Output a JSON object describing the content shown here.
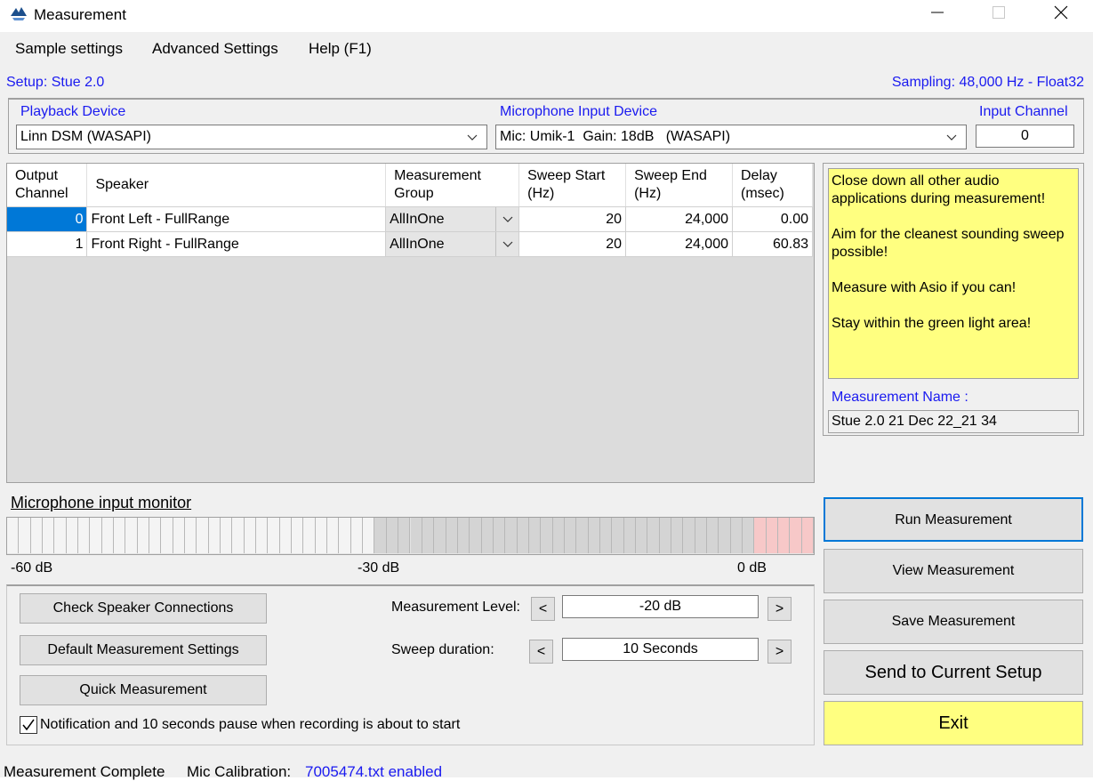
{
  "window": {
    "title": "Measurement",
    "controls": [
      "minimize",
      "maximize",
      "close"
    ]
  },
  "menu": [
    "Sample settings",
    "Advanced Settings",
    "Help (F1)"
  ],
  "setup": {
    "label": "Setup: Stue 2.0",
    "sampling": "Sampling: 48,000 Hz - Float32"
  },
  "devices": {
    "playback_label": "Playback Device",
    "playback_value": "Linn DSM (WASAPI)",
    "mic_label": "Microphone Input Device",
    "mic_value": "Mic: Umik-1  Gain: 18dB   (WASAPI)",
    "input_channel_label": "Input Channel",
    "input_channel_value": "0"
  },
  "table": {
    "headers": {
      "output_channel": [
        "Output",
        "Channel"
      ],
      "speaker": [
        "Speaker"
      ],
      "group": [
        "Measurement",
        "Group"
      ],
      "sweep_start": [
        "Sweep Start",
        "(Hz)"
      ],
      "sweep_end": [
        "Sweep End",
        "(Hz)"
      ],
      "delay": [
        "Delay",
        "(msec)"
      ]
    },
    "rows": [
      {
        "channel": "0",
        "speaker": "Front Left - FullRange",
        "group": "AllInOne",
        "sweep_start": "20",
        "sweep_end": "24,000",
        "delay": "0.00",
        "selected": true
      },
      {
        "channel": "1",
        "speaker": "Front Right - FullRange",
        "group": "AllInOne",
        "sweep_start": "20",
        "sweep_end": "24,000",
        "delay": "60.83",
        "selected": false
      }
    ]
  },
  "notes": [
    "Close down all other audio applications during measurement!",
    "Aim for the cleanest sounding sweep possible!",
    "Measure with Asio if you can!",
    "Stay within the green light area!"
  ],
  "measurement_name": {
    "label": "Measurement Name :",
    "value": "Stue 2.0 21 Dec 22_21 34"
  },
  "monitor": {
    "title": "Microphone input monitor",
    "scale": [
      "-60 dB",
      "-30 dB",
      "0 dB"
    ],
    "level": 0
  },
  "actions": {
    "run": "Run Measurement",
    "view": "View Measurement",
    "save": "Save Measurement",
    "send": "Send to Current Setup",
    "exit": "Exit"
  },
  "settings": {
    "check_connections": "Check Speaker Connections",
    "defaults": "Default Measurement Settings",
    "quick": "Quick Measurement",
    "level_label": "Measurement Level:",
    "level_value": "-20 dB",
    "duration_label": "Sweep duration:",
    "duration_value": "10 Seconds",
    "decrease": "<",
    "increase": ">",
    "notify_checked": true,
    "notify_label": "Notification and 10 seconds pause when recording is about to start"
  },
  "status": {
    "text": "Measurement Complete",
    "mic_cal_label": "Mic Calibration:",
    "mic_cal_value": "7005474.txt enabled"
  }
}
